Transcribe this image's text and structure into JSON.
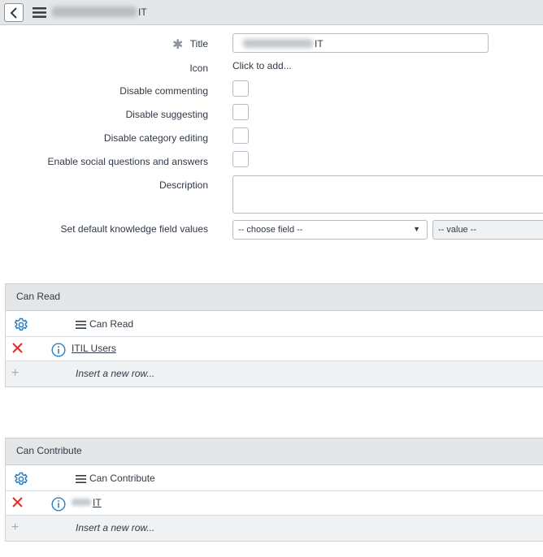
{
  "header": {
    "title_suffix": "IT",
    "icons": [
      "chevron-left-icon",
      "hamburger-menu-icon"
    ]
  },
  "form": {
    "title_label": "Title",
    "title_mandatory_marker": "✱",
    "title_value_suffix": "IT",
    "icon_label": "Icon",
    "icon_value": "Click to add...",
    "disable_commenting_label": "Disable commenting",
    "disable_suggesting_label": "Disable suggesting",
    "disable_category_editing_label": "Disable category editing",
    "enable_social_qa_label": "Enable social questions and answers",
    "description_label": "Description",
    "default_fields_label": "Set default knowledge field values",
    "field_select_value": "-- choose field --",
    "value_select_value": "-- value --",
    "checkboxes": {
      "disable_commenting": false,
      "disable_suggesting": false,
      "disable_category_editing": false,
      "enable_social_qa": false
    }
  },
  "can_read": {
    "section_title": "Can Read",
    "column_header": "Can Read",
    "rows": [
      {
        "label": "ITIL Users"
      }
    ],
    "insert_text": "Insert a new row..."
  },
  "can_contribute": {
    "section_title": "Can Contribute",
    "column_header": "Can Contribute",
    "rows": [
      {
        "label_suffix": "IT"
      }
    ],
    "insert_text": "Insert a new row..."
  },
  "colors": {
    "header_bg": "#e4e6e7",
    "gear_blue": "#2b7fc1",
    "delete_red": "#d8312b",
    "info_blue": "#2b7fc1"
  }
}
